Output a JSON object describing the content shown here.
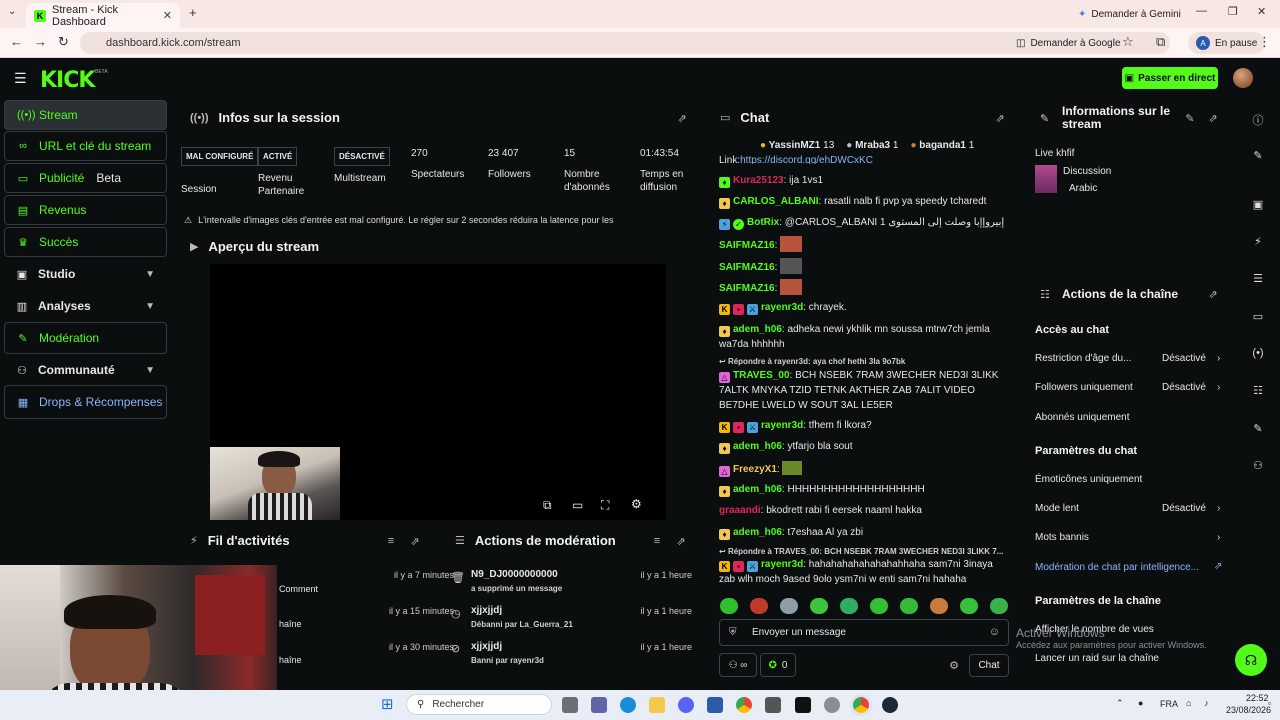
{
  "browser": {
    "tab_title": "Stream - Kick Dashboard",
    "url": "dashboard.kick.com/stream",
    "gemini_button": "Demander à Gemini",
    "google_button": "Demander à Google",
    "profile_status": "En pause",
    "profile_initial": "A"
  },
  "header": {
    "logo": "KICK",
    "logo_sup": "BETA",
    "go_live": "Passer en direct"
  },
  "sidebar": {
    "items": [
      {
        "label": "Stream"
      },
      {
        "label": "URL et clé du stream"
      },
      {
        "label": "Publicité",
        "badge": "Beta"
      },
      {
        "label": "Revenus"
      },
      {
        "label": "Succès"
      },
      {
        "label": "Studio"
      },
      {
        "label": "Analyses"
      },
      {
        "label": "Modération"
      },
      {
        "label": "Communauté"
      },
      {
        "label": "Drops & Récompenses"
      }
    ]
  },
  "session": {
    "title": "Infos sur la session",
    "badges": [
      "MAL CONFIGURÉ",
      "ACTIVÉ",
      "DÉSACTIVÉ"
    ],
    "labels": {
      "session": "Session",
      "revenue": "Revenu Partenaire",
      "multistream": "Multistream",
      "viewers": "Spectateurs",
      "followers": "Followers",
      "subs": "Nombre d'abonnés",
      "uptime": "Temps en diffusion"
    },
    "values": {
      "viewers": "270",
      "followers": "23 407",
      "subs": "15",
      "uptime": "01:43:54"
    },
    "warning": "L'intervalle d'images clés d'entrée est mal configuré. Le régler sur 2 secondes réduira la latence pour les"
  },
  "preview": {
    "title": "Aperçu du stream"
  },
  "activity": {
    "title": "Fil d'activités",
    "items": [
      {
        "text": "Comment",
        "time": "il y a 7 minutes"
      },
      {
        "text": "haîne",
        "time": "il y a 15 minutes"
      },
      {
        "text": "haîne",
        "time": "il y a 30 minutes"
      }
    ]
  },
  "modactions": {
    "title": "Actions de modération",
    "items": [
      {
        "user": "N9_DJ0000000000",
        "desc": "a supprimé un message",
        "time": "il y a 1 heure"
      },
      {
        "user": "xjjxjjdj",
        "desc": "Débanni par La_Guerra_21",
        "time": "il y a 1 heure"
      },
      {
        "user": "xjjxjjdj",
        "desc": "Banni par rayenr3d",
        "time": "il y a 1 heure"
      }
    ]
  },
  "chat": {
    "title": "Chat",
    "top_gifters": [
      {
        "name": "YassinMZ1",
        "count": "13"
      },
      {
        "name": "Mraba3",
        "count": "1"
      },
      {
        "name": "baganda1",
        "count": "1"
      }
    ],
    "link_prefix": "Link:",
    "link": "https://discord.gg/ehDWCxKC",
    "messages": [
      {
        "user": "Kura25123",
        "color": "#e0245e",
        "text": ": ija 1vs1"
      },
      {
        "user": "CARLOS_ALBANI",
        "color": "#53fc18",
        "text": ": rasatli nalb fi pvp ya speedy tcharedt"
      },
      {
        "user": "BotRix",
        "color": "#53fc18",
        "text": ": @CARLOS_ALBANI 1 ‏إبيروإإبا وصلت إلى المستوى"
      },
      {
        "user": "SAIFMAZ16",
        "color": "#53fc18",
        "text": ":"
      },
      {
        "user": "SAIFMAZ16",
        "color": "#53fc18",
        "text": ":"
      },
      {
        "user": "SAIFMAZ16",
        "color": "#53fc18",
        "text": ":"
      },
      {
        "user": "rayenr3d",
        "color": "#53fc18",
        "text": ": chrayek."
      },
      {
        "user": "adem_h06",
        "color": "#53fc18",
        "text": ": adheka newi ykhlik mn soussa mtrw7ch jemla wa7da hhhhhh"
      },
      {
        "user": "TRAVES_00",
        "color": "#53fc18",
        "text": ": BCH NSEBK 7RAM 3WECHER NED3I 3LIKK 7ALTK MNYKA TZID TETNK AKTHER ZAB 7ALIT VIDEO BE7DHE LWELD W SOUT 3AL LE5ER"
      },
      {
        "user": "rayenr3d",
        "color": "#53fc18",
        "text": ": tfhem fi lkora?"
      },
      {
        "user": "adem_h06",
        "color": "#53fc18",
        "text": ": ytfarjo bla sout"
      },
      {
        "user": "FreezyX1",
        "color": "#f2c94c",
        "text": ":"
      },
      {
        "user": "adem_h06",
        "color": "#53fc18",
        "text": ": HHHHHHHHHHHHHHHHHHH"
      },
      {
        "user": "graaandi",
        "color": "#e0245e",
        "text": ": bkodrett rabi fi eersek naaml hakka"
      },
      {
        "user": "adem_h06",
        "color": "#53fc18",
        "text": ": t7eshaa Al ya zbi"
      },
      {
        "user": "rayenr3d",
        "color": "#53fc18",
        "text": ": hahahahahahahahahhaha sam7ni 3inaya zab wlh moch 9ased 9olo ysm7ni w enti sam7ni hahaha"
      }
    ],
    "reply1": "Répondre à rayenr3d: aya chof hethi 3la 9o7bk",
    "reply2": "Répondre à TRAVES_00: BCH NSEBK 7RAM 3WECHER NED3I 3LIKK 7...",
    "input_placeholder": "Envoyer un message",
    "points": "0",
    "send": "Chat"
  },
  "streaminfo": {
    "title": "Informations sur le stream",
    "stream_title": "Live khfif",
    "category": "Discussion",
    "language": "Arabic"
  },
  "channelactions": {
    "title": "Actions de la chaîne",
    "chat_access": "Accès au chat",
    "age_restriction": "Restriction d'âge du...",
    "age_value": "Désactivé",
    "followers_only": "Followers uniquement",
    "followers_value": "Désactivé",
    "subs_only": "Abonnés uniquement",
    "chat_settings": "Paramètres du chat",
    "emotes_only": "Émoticônes uniquement",
    "slow_mode": "Mode lent",
    "slow_value": "Désactivé",
    "banned_words": "Mots bannis",
    "ai_moderation": "Modération de chat par intelligence...",
    "channel_settings": "Paramètres de la chaîne",
    "show_viewers": "Afficher le nombre de vues",
    "raid": "Lancer un raid sur la chaîne"
  },
  "windows": {
    "watermark_line1": "Activer Windows",
    "watermark_line2": "Accédez aux paramètres pour activer Windows.",
    "search": "Rechercher",
    "lang": "FRA",
    "time": "22:52",
    "date": "23/08/2026"
  },
  "colors": {
    "kick_green": "#53fc18",
    "bg": "#0b0e0f"
  }
}
